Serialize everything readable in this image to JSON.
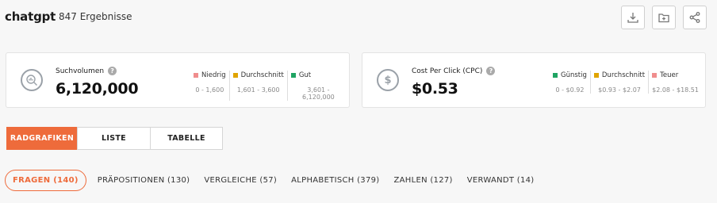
{
  "header": {
    "keyword": "chatgpt",
    "results": "847 Ergebnisse",
    "actions": [
      "download-icon",
      "folder-add-icon",
      "share-icon"
    ]
  },
  "search_volume": {
    "label": "Suchvolumen",
    "value": "6,120,000",
    "legend": [
      {
        "name": "Niedrig",
        "range": "0 - 1,600",
        "color": "#f08d8d"
      },
      {
        "name": "Durchschnitt",
        "range": "1,601 - 3,600",
        "color": "#e0a400"
      },
      {
        "name": "Gut",
        "range": "3,601 - 6,120,000",
        "color": "#1fa463"
      }
    ]
  },
  "cpc": {
    "label": "Cost Per Click (CPC)",
    "value": "$0.53",
    "legend": [
      {
        "name": "Günstig",
        "range": "0 - $0.92",
        "color": "#1fa463"
      },
      {
        "name": "Durchschnitt",
        "range": "$0.93 - $2.07",
        "color": "#e0a400"
      },
      {
        "name": "Teuer",
        "range": "$2.08 - $18.51",
        "color": "#f08d8d"
      }
    ]
  },
  "view_tabs": [
    "RADGRAFIKEN",
    "LISTE",
    "TABELLE"
  ],
  "category_tabs": [
    "FRAGEN (140)",
    "PRÄPOSITIONEN (130)",
    "VERGLEICHE (57)",
    "ALPHABETISCH (379)",
    "ZAHLEN (127)",
    "VERWANDT (14)"
  ],
  "colors": {
    "accent": "#ee6b3b"
  }
}
